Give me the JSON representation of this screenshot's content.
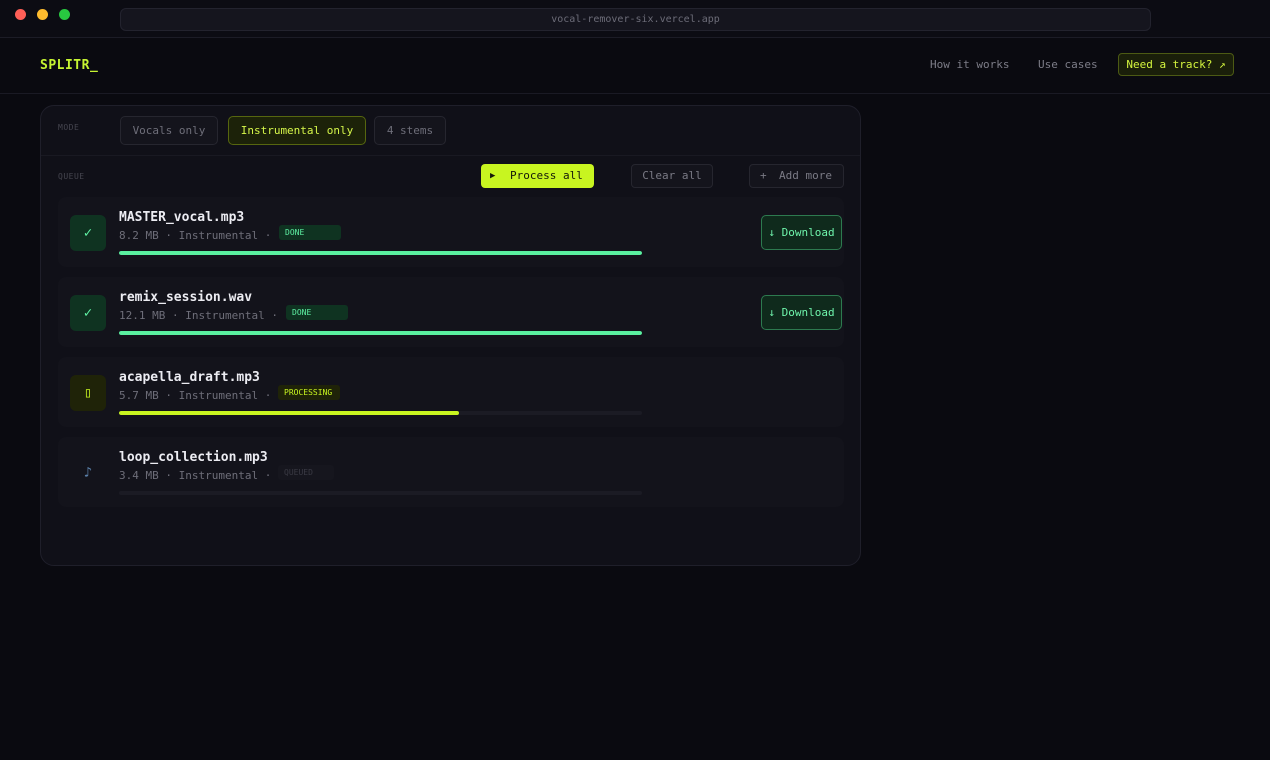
{
  "browser": {
    "url": "vocal-remover-six.vercel.app"
  },
  "header": {
    "logo": "SPLITR_",
    "nav": [
      "How it works",
      "Use cases"
    ],
    "cta": "Need a track? ↗"
  },
  "mode": {
    "label": "MODE",
    "options": [
      "Vocals only",
      "Instrumental only",
      "4 stems"
    ],
    "selected": "Instrumental only"
  },
  "queue": {
    "label": "QUEUE",
    "process_label": "Process all",
    "process_icon": "▶",
    "clear_label": "Clear all",
    "add_icon": "+",
    "add_label": "Add more",
    "items": [
      {
        "name": "MASTER_vocal.mp3",
        "meta": "8.2 MB · Instrumental ·",
        "status": "DONE",
        "progress": 1.0,
        "icon": "✓",
        "action": "↓ Download"
      },
      {
        "name": "remix_session.wav",
        "meta": "12.1 MB · Instrumental ·",
        "status": "DONE",
        "progress": 1.0,
        "icon": "✓",
        "action": "↓ Download"
      },
      {
        "name": "acapella_draft.mp3",
        "meta": "5.7 MB · Instrumental ·",
        "status": "PROCESSING",
        "progress": 0.65,
        "icon": "▯"
      },
      {
        "name": "loop_collection.mp3",
        "meta": "3.4 MB · Instrumental ·",
        "status": "QUEUED",
        "progress": 0.0,
        "icon": "♪"
      }
    ]
  },
  "colors": {
    "accent": "#c8f520",
    "success": "#5af0a0",
    "background": "#0a0a10"
  }
}
